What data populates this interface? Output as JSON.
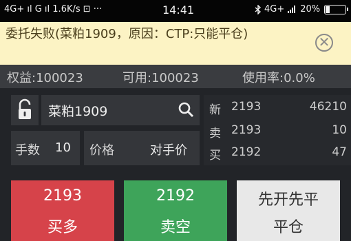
{
  "status_bar": {
    "left": "4G+ ıl G ıl 1.6K/s ⊡ ···",
    "time": "14:41",
    "network": "4G+",
    "battery": "20%",
    "battery_level": 0.2
  },
  "notice": {
    "message": "委托失败(菜粕1909，原因：CTP:只能平仓)",
    "close_glyph": "✕"
  },
  "account": {
    "equity": "权益:100023",
    "available": "可用:100023",
    "usage": "使用率:0.0%"
  },
  "order_form": {
    "symbol": "菜粕1909",
    "lots_label": "手数",
    "lots_value": "10",
    "price_label": "价格",
    "price_value": "对手价"
  },
  "quotes": [
    {
      "label": "新",
      "price": "2193",
      "volume": "46210"
    },
    {
      "label": "卖",
      "price": "2193",
      "volume": "10"
    },
    {
      "label": "买",
      "price": "2192",
      "volume": "47"
    }
  ],
  "actions": {
    "buy": {
      "price": "2193",
      "label": "买多"
    },
    "sell": {
      "price": "2192",
      "label": "卖空"
    },
    "close": {
      "line1": "先开先平",
      "line2": "平仓"
    }
  },
  "colors": {
    "buy": "#d6434a",
    "sell": "#3ea45a",
    "close": "#e8e8e8",
    "notice_bg": "#fcf3c4"
  },
  "icons": [
    "lock-open-icon",
    "search-icon",
    "bluetooth-icon",
    "close-circle-icon"
  ]
}
